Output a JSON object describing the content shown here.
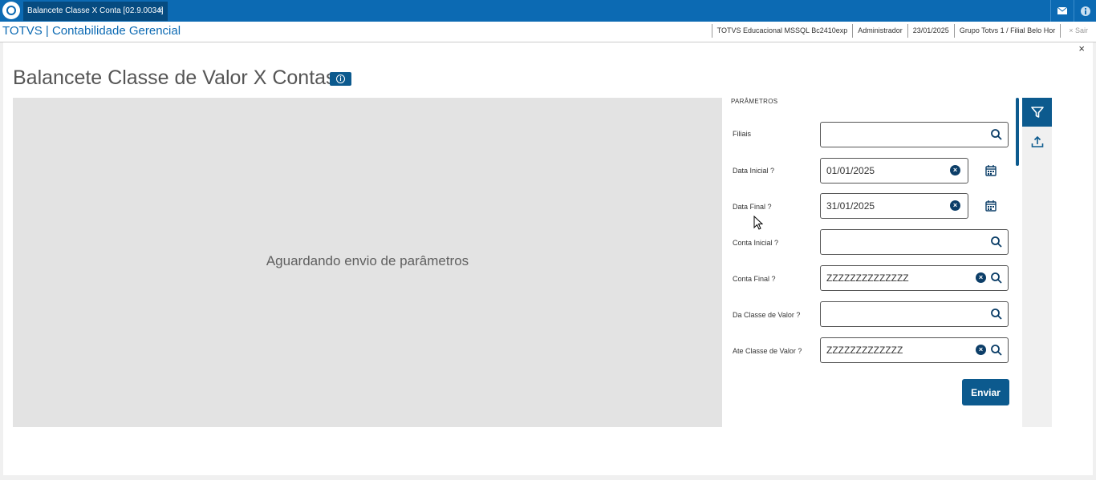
{
  "window": {
    "tab_label": "Balancete Classe X Conta [02.9.0034]",
    "tab_close": "×"
  },
  "header": {
    "app_title": "TOTVS | Contabilidade Gerencial",
    "environment": "TOTVS Educacional MSSQL Bc2410exp",
    "user": "Administrador",
    "date": "23/01/2025",
    "branch": "Grupo Totvs 1 / Filial Belo Hor",
    "exit_icon": "×",
    "exit_label": "Sair"
  },
  "page": {
    "title": "Balancete Classe de Valor X Contas",
    "close": "×",
    "info_glyph": "i",
    "preview_message": "Aguardando envio de parâmetros"
  },
  "params": {
    "title": "PARÂMETROS",
    "fields": [
      {
        "label": "Filiais",
        "value": ""
      },
      {
        "label": "Data Inicial ?",
        "value": "01/01/2025"
      },
      {
        "label": "Data Final ?",
        "value": "31/01/2025"
      },
      {
        "label": "Conta Inicial ?",
        "value": ""
      },
      {
        "label": "Conta Final ?",
        "value": "ZZZZZZZZZZZZZZ"
      },
      {
        "label": "Da Classe de Valor ?",
        "value": ""
      },
      {
        "label": "Ate Classe de Valor ?",
        "value": "ZZZZZZZZZZZZZ"
      }
    ],
    "clear_glyph": "×",
    "submit_label": "Enviar"
  },
  "colors": {
    "brand": "#0c6ab3",
    "dark_accent": "#0c5a8e"
  }
}
